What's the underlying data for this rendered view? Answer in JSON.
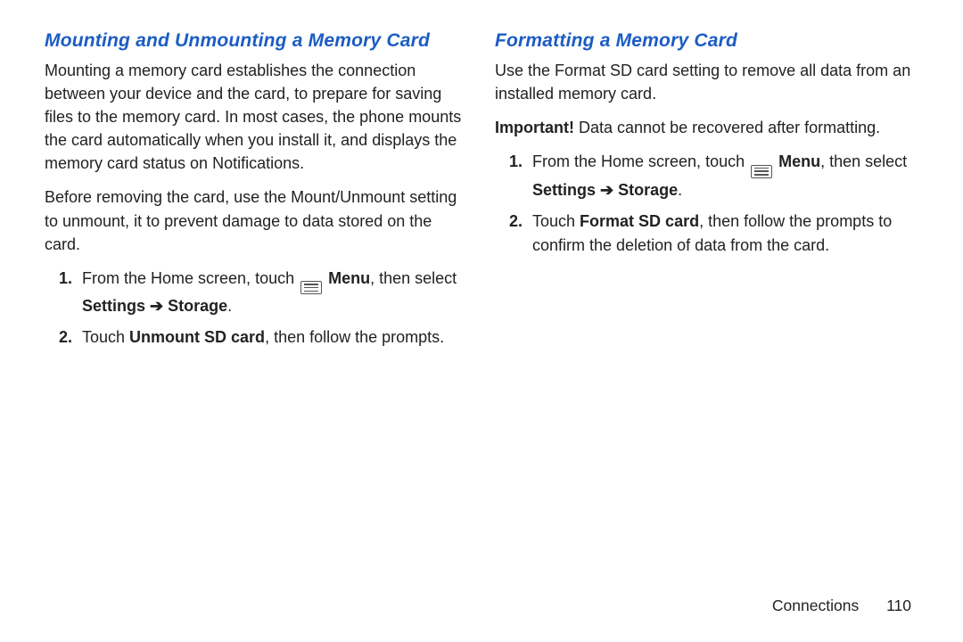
{
  "left": {
    "heading": "Mounting and Unmounting a Memory Card",
    "p1": "Mounting a memory card establishes the connection between your device and the card, to prepare for saving files to the memory card. In most cases, the phone mounts the card automatically when you install it, and displays the memory card status on Notifications.",
    "p2": "Before removing the card, use the Mount/Unmount setting to unmount, it to prevent damage to data stored on the card.",
    "step1_pre": "From the Home screen, touch ",
    "step1_menu": "Menu",
    "step1_post": ", then select ",
    "step1_settings": "Settings ",
    "step1_arrow": "➔",
    "step1_storage": " Storage",
    "step1_end": ".",
    "step2_pre": "Touch ",
    "step2_bold": "Unmount SD card",
    "step2_post": ", then follow the prompts."
  },
  "right": {
    "heading": "Formatting a Memory Card",
    "p1": "Use the Format SD card setting to remove all data from an installed memory card.",
    "important_label": "Important!",
    "important_text": " Data cannot be recovered after formatting.",
    "step1_pre": "From the Home screen, touch ",
    "step1_menu": "Menu",
    "step1_post": ", then select ",
    "step1_settings": "Settings ",
    "step1_arrow": "➔",
    "step1_storage": " Storage",
    "step1_end": ".",
    "step2_pre": "Touch ",
    "step2_bold": "Format SD card",
    "step2_post": ", then follow the prompts to confirm the deletion of data from the card."
  },
  "footer": {
    "chapter": "Connections",
    "page": "110"
  }
}
